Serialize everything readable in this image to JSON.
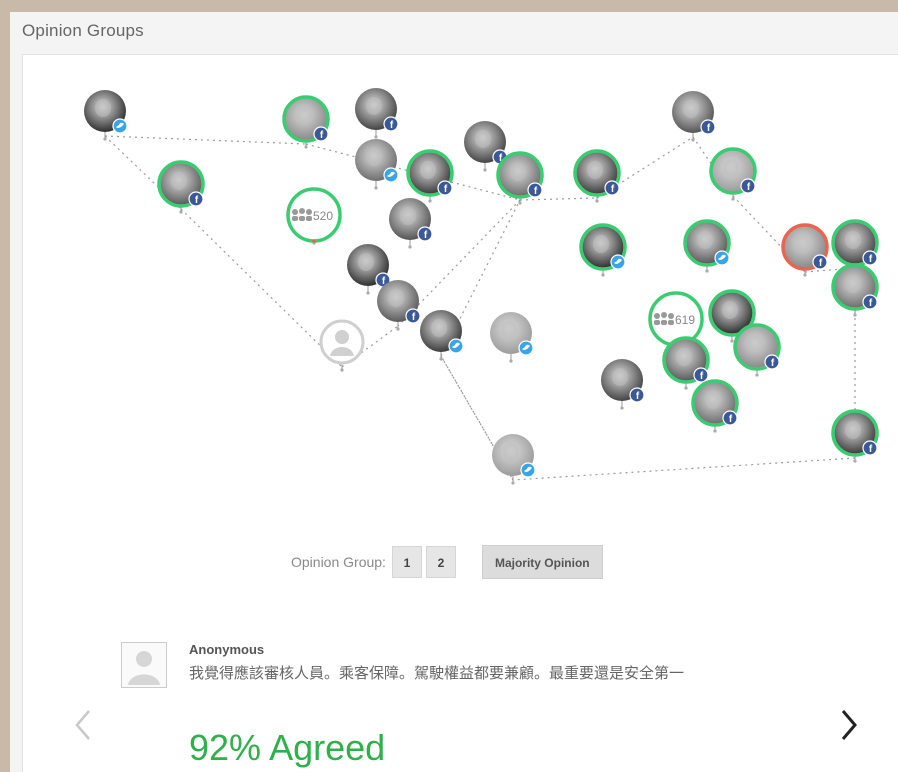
{
  "panel_title": "Opinion Groups",
  "colors": {
    "agree_ring": "#3bcc72",
    "disagree_ring": "#e8664f",
    "twitter": "#3aa4e8",
    "facebook": "#3b5998",
    "agreed_text": "#2eb04a"
  },
  "participants": [
    {
      "kind": "photo",
      "ring": "none",
      "badge": "twitter"
    },
    {
      "kind": "photo",
      "ring": "green",
      "badge": "facebook"
    },
    {
      "kind": "photo",
      "ring": "green",
      "badge": "facebook"
    },
    {
      "kind": "photo",
      "ring": "none",
      "badge": "facebook"
    },
    {
      "kind": "photo",
      "ring": "none",
      "badge": "twitter"
    },
    {
      "kind": "photo",
      "ring": "green",
      "badge": "facebook"
    },
    {
      "kind": "group",
      "count": "520",
      "ring": "green"
    },
    {
      "kind": "photo",
      "ring": "none",
      "badge": "facebook"
    },
    {
      "kind": "photo",
      "ring": "none",
      "badge": "facebook"
    },
    {
      "kind": "photo",
      "ring": "none",
      "badge": "facebook"
    },
    {
      "kind": "anonymous",
      "ring": "none"
    },
    {
      "kind": "photo",
      "ring": "none",
      "badge": "facebook"
    },
    {
      "kind": "photo",
      "ring": "green",
      "badge": "facebook"
    },
    {
      "kind": "photo",
      "ring": "green",
      "badge": "facebook"
    },
    {
      "kind": "photo",
      "ring": "green",
      "badge": "facebook"
    },
    {
      "kind": "photo",
      "ring": "none",
      "badge": "facebook"
    },
    {
      "kind": "photo",
      "ring": "green",
      "badge": "twitter"
    },
    {
      "kind": "photo",
      "ring": "green",
      "badge": "twitter"
    },
    {
      "kind": "photo",
      "ring": "red",
      "badge": "facebook"
    },
    {
      "kind": "photo",
      "ring": "green",
      "badge": "facebook"
    },
    {
      "kind": "photo",
      "ring": "green",
      "badge": "facebook"
    },
    {
      "kind": "photo",
      "ring": "none",
      "badge": "twitter"
    },
    {
      "kind": "photo",
      "ring": "none",
      "badge": "twitter"
    },
    {
      "kind": "group",
      "count": "619",
      "ring": "green"
    },
    {
      "kind": "photo",
      "ring": "green",
      "badge": "none"
    },
    {
      "kind": "photo",
      "ring": "green",
      "badge": "facebook"
    },
    {
      "kind": "photo",
      "ring": "green",
      "badge": "facebook"
    },
    {
      "kind": "photo",
      "ring": "none",
      "badge": "facebook"
    },
    {
      "kind": "photo",
      "ring": "green",
      "badge": "facebook"
    },
    {
      "kind": "photo",
      "ring": "green",
      "badge": "facebook"
    },
    {
      "kind": "photo",
      "ring": "none",
      "badge": "twitter"
    }
  ],
  "controls": {
    "group_label": "Opinion Group:",
    "groups": [
      "1",
      "2"
    ],
    "majority_label": "Majority Opinion"
  },
  "comment": {
    "author": "Anonymous",
    "text": "我覺得應該審核人員。乘客保障。駕駛權益都要兼顧。最重要還是安全第一",
    "agreed": "92% Agreed"
  },
  "nav": {
    "prev_icon": "chevron-left-icon",
    "next_icon": "chevron-right-icon"
  }
}
